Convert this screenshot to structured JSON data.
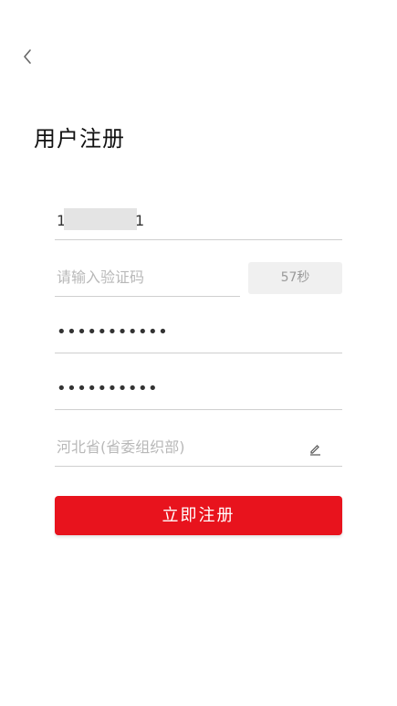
{
  "header": {
    "back_icon": "chevron-left-icon",
    "title": "用户注册"
  },
  "form": {
    "phone_prefix": "1",
    "phone_suffix": "1",
    "code_placeholder": "请输入验证码",
    "countdown_label": "57秒",
    "password_value": "•••••••••••",
    "password_confirm_value": "••••••••••",
    "organization_value": "河北省(省委组织部)",
    "edit_icon": "pencil-icon"
  },
  "actions": {
    "submit_label": "立即注册"
  },
  "colors": {
    "accent": "#e8131d",
    "placeholder": "#b8b8b8",
    "divider": "#cfcfcf"
  }
}
